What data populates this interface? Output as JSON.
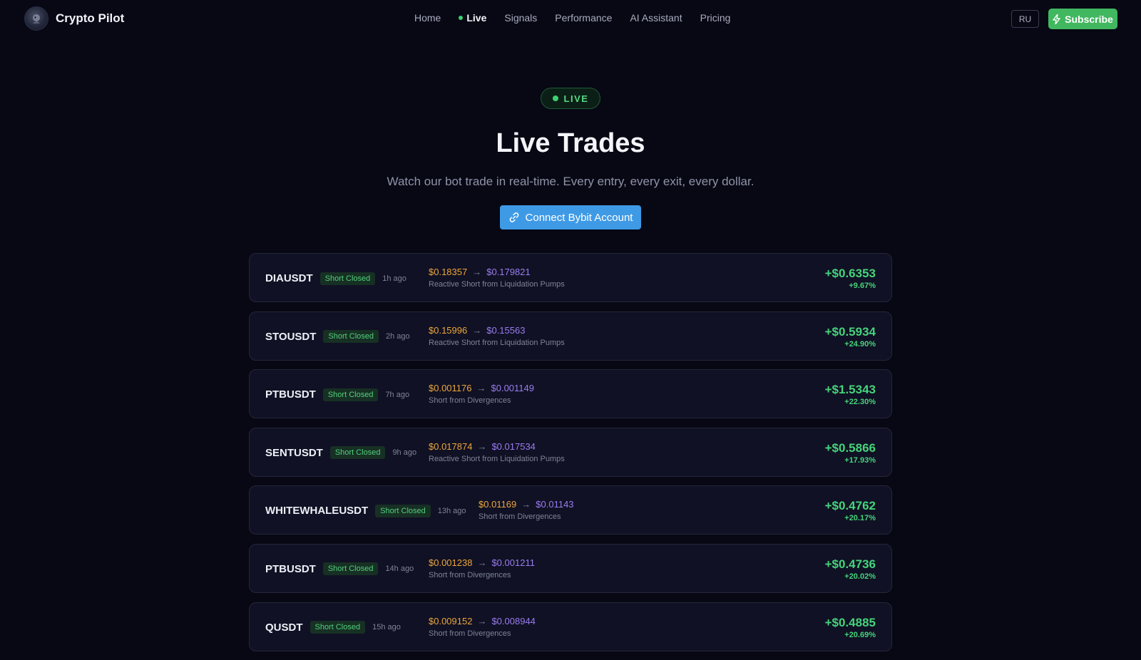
{
  "brand": {
    "name": "Crypto Pilot"
  },
  "nav": {
    "links": [
      {
        "label": "Home"
      },
      {
        "label": "Live"
      },
      {
        "label": "Signals"
      },
      {
        "label": "Performance"
      },
      {
        "label": "AI Assistant"
      },
      {
        "label": "Pricing"
      }
    ],
    "lang_label": "RU",
    "subscribe_label": "Subscribe"
  },
  "hero": {
    "badge": "LIVE",
    "title": "Live Trades",
    "subtitle": "Watch our bot trade in real-time. Every entry, every exit, every dollar.",
    "connect_label": "Connect Bybit Account"
  },
  "colors": {
    "profit": "#45d47a",
    "entry_price": "#eda63b",
    "exit_price": "#9a7cf0",
    "subscribe_bg": "#41b760",
    "connect_bg": "#3f9ae6"
  },
  "trades": [
    {
      "symbol": "DIAUSDT",
      "status": "Short Closed",
      "time": "1h ago",
      "entry": "$0.18357",
      "exit": "$0.179821",
      "strategy": "Reactive Short from Liquidation Pumps",
      "pnl": "+$0.6353",
      "pct": "+9.67%"
    },
    {
      "symbol": "STOUSDT",
      "status": "Short Closed",
      "time": "2h ago",
      "entry": "$0.15996",
      "exit": "$0.15563",
      "strategy": "Reactive Short from Liquidation Pumps",
      "pnl": "+$0.5934",
      "pct": "+24.90%"
    },
    {
      "symbol": "PTBUSDT",
      "status": "Short Closed",
      "time": "7h ago",
      "entry": "$0.001176",
      "exit": "$0.001149",
      "strategy": "Short from Divergences",
      "pnl": "+$1.5343",
      "pct": "+22.30%"
    },
    {
      "symbol": "SENTUSDT",
      "status": "Short Closed",
      "time": "9h ago",
      "entry": "$0.017874",
      "exit": "$0.017534",
      "strategy": "Reactive Short from Liquidation Pumps",
      "pnl": "+$0.5866",
      "pct": "+17.93%"
    },
    {
      "symbol": "WHITEWHALEUSDT",
      "status": "Short Closed",
      "time": "13h ago",
      "entry": "$0.01169",
      "exit": "$0.01143",
      "strategy": "Short from Divergences",
      "pnl": "+$0.4762",
      "pct": "+20.17%"
    },
    {
      "symbol": "PTBUSDT",
      "status": "Short Closed",
      "time": "14h ago",
      "entry": "$0.001238",
      "exit": "$0.001211",
      "strategy": "Short from Divergences",
      "pnl": "+$0.4736",
      "pct": "+20.02%"
    },
    {
      "symbol": "QUSDT",
      "status": "Short Closed",
      "time": "15h ago",
      "entry": "$0.009152",
      "exit": "$0.008944",
      "strategy": "Short from Divergences",
      "pnl": "+$0.4885",
      "pct": "+20.69%"
    }
  ]
}
